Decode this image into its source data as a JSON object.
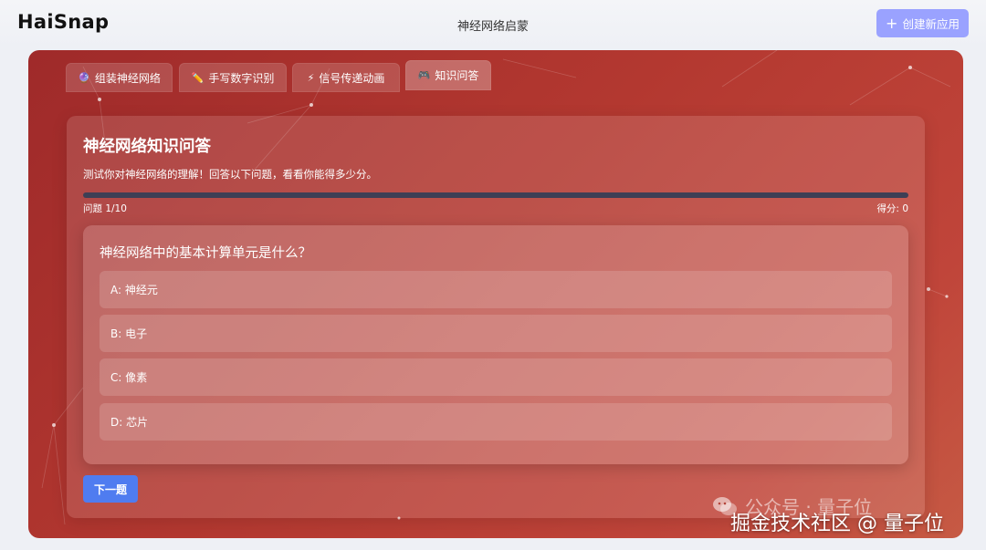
{
  "header": {
    "logo": "HaiSnap",
    "title": "神经网络启蒙",
    "create_button": "创建新应用"
  },
  "tabs": [
    {
      "icon": "🔮",
      "label": "组装神经网络",
      "active": false
    },
    {
      "icon": "✏️",
      "label": "手写数字识别",
      "active": false
    },
    {
      "icon": "⚡",
      "label": "信号传递动画",
      "active": false
    },
    {
      "icon": "🎮",
      "label": "知识问答",
      "active": true
    }
  ],
  "quiz": {
    "title": "神经网络知识问答",
    "description": "测试你对神经网络的理解！回答以下问题，看看你能得多少分。",
    "progress": 0,
    "question_counter": "问题 1/10",
    "score": "得分: 0",
    "question": "神经网络中的基本计算单元是什么？",
    "options": [
      "A: 神经元",
      "B: 电子",
      "C: 像素",
      "D: 芯片"
    ],
    "next_button": "下一题"
  },
  "watermark": {
    "line1": "公众号 · 量子位",
    "line2": "掘金技术社区 @ 量子位"
  },
  "colors": {
    "stage_start": "#9f2a2a",
    "stage_end": "#c65a44",
    "primary_button": "#4f7cf0",
    "create_button": "#9aa2ff",
    "progress_track": "#3e3f55"
  }
}
